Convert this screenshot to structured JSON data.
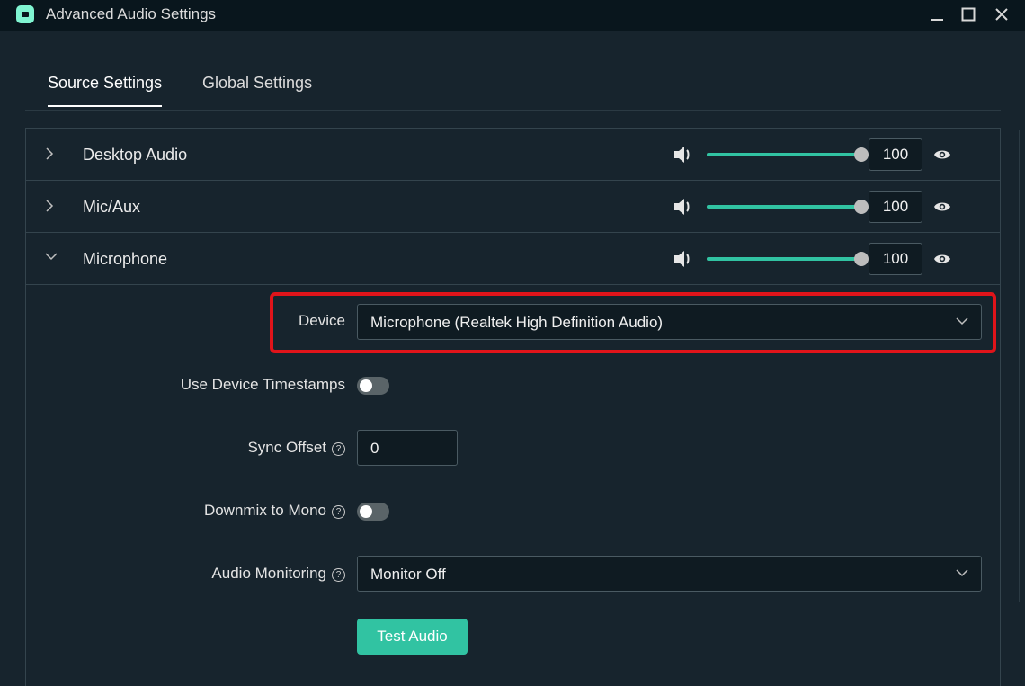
{
  "window": {
    "title": "Advanced Audio Settings"
  },
  "tabs": [
    {
      "label": "Source Settings",
      "active": true
    },
    {
      "label": "Global Settings",
      "active": false
    }
  ],
  "sources": [
    {
      "name": "Desktop Audio",
      "volume": "100",
      "expanded": false,
      "volume_level": 1.0
    },
    {
      "name": "Mic/Aux",
      "volume": "100",
      "expanded": false,
      "volume_level": 1.0
    },
    {
      "name": "Microphone",
      "volume": "100",
      "expanded": true,
      "volume_level": 1.0
    }
  ],
  "microphone_settings": {
    "device_label": "Device",
    "device_value": "Microphone (Realtek High Definition Audio)",
    "timestamps_label": "Use Device Timestamps",
    "timestamps_on": false,
    "sync_offset_label": "Sync Offset",
    "sync_offset_value": "0",
    "downmix_label": "Downmix to Mono",
    "downmix_on": false,
    "monitoring_label": "Audio Monitoring",
    "monitoring_value": "Monitor Off",
    "test_button": "Test Audio",
    "help_glyph": "?"
  },
  "colors": {
    "accent": "#31c3a2",
    "highlight": "#e0141a",
    "background": "#17242d",
    "titlebar": "#09161d"
  }
}
